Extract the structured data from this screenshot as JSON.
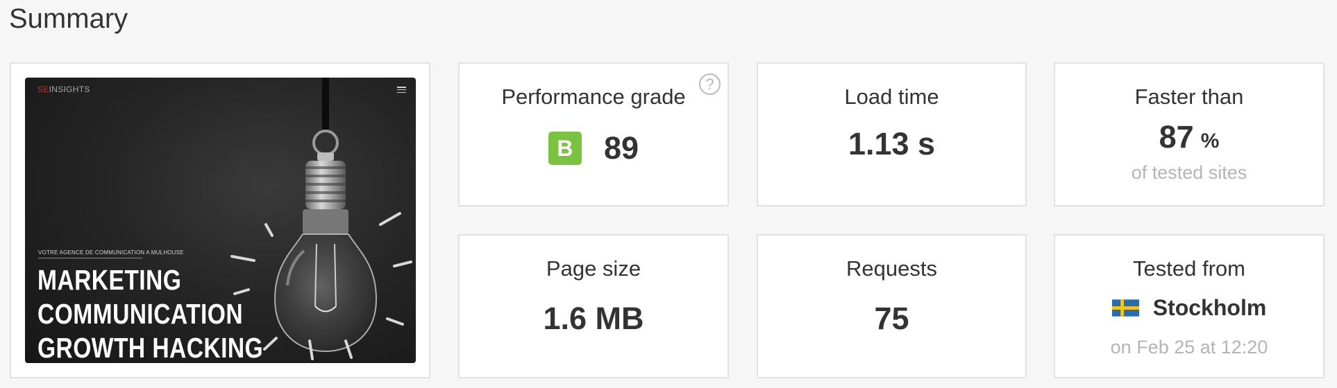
{
  "section": {
    "title": "Summary"
  },
  "screenshot": {
    "logo_prefix": "SE",
    "logo_suffix": "INSIGHTS",
    "tagline": "VOTRE AGENCE DE COMMUNICATION A MULHOUSE",
    "headline_lines": [
      "MARKETING",
      "COMMUNICATION",
      "GROWTH HACKING"
    ]
  },
  "performance": {
    "label": "Performance grade",
    "grade": "B",
    "score": "89",
    "grade_color": "#7cc242",
    "help_symbol": "?"
  },
  "load_time": {
    "label": "Load time",
    "value": "1.13 s"
  },
  "faster_than": {
    "label": "Faster than",
    "value": "87",
    "unit": "%",
    "sub": "of tested sites"
  },
  "page_size": {
    "label": "Page size",
    "value": "1.6 MB"
  },
  "requests": {
    "label": "Requests",
    "value": "75"
  },
  "tested_from": {
    "label": "Tested from",
    "location": "Stockholm",
    "flag_icon": "sweden-flag-icon",
    "date": "on Feb 25 at 12:20"
  },
  "colors": {
    "background": "#f6f6f6",
    "card_border": "#e2e2e2",
    "muted_text": "#b4b4b4",
    "flag_blue": "#2a6ab0",
    "flag_yellow": "#f5c518"
  }
}
